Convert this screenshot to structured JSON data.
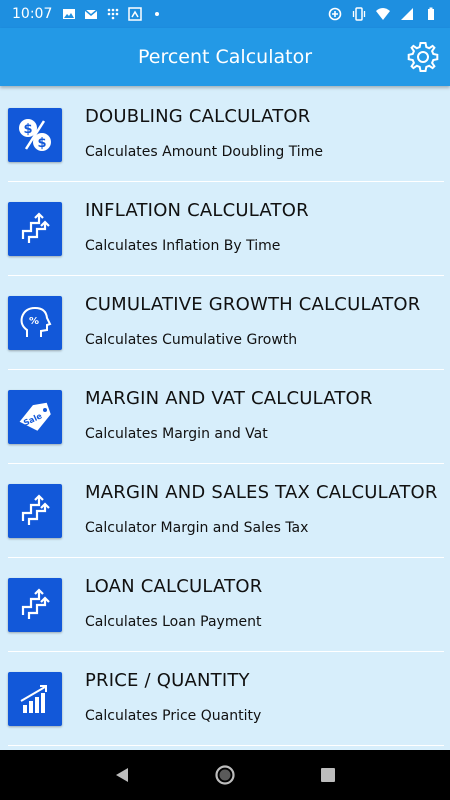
{
  "status_bar": {
    "time": "10:07",
    "icons_left": [
      "image-icon",
      "mail-icon",
      "dialpad-icon",
      "screen-icon",
      "dot-icon"
    ],
    "icons_right": [
      "data-saver-icon",
      "vibrate-icon",
      "wifi-icon",
      "signal-icon",
      "battery-icon"
    ]
  },
  "app_bar": {
    "title": "Percent Calculator",
    "settings_icon": "gear-icon"
  },
  "items": [
    {
      "title": "DOUBLING CALCULATOR",
      "subtitle": "Calculates Amount Doubling Time",
      "icon": "dollar-percent-icon"
    },
    {
      "title": "INFLATION CALCULATOR",
      "subtitle": "Calculates Inflation By Time",
      "icon": "arrows-icon"
    },
    {
      "title": "CUMULATIVE GROWTH CALCULATOR",
      "subtitle": "Calculates Cumulative Growth",
      "icon": "head-percent-icon"
    },
    {
      "title": "MARGIN AND VAT CALCULATOR",
      "subtitle": "Calculates Margin and Vat",
      "icon": "sale-tag-icon"
    },
    {
      "title": "MARGIN AND SALES TAX CALCULATOR",
      "subtitle": "Calculator Margin and Sales Tax",
      "icon": "arrows-icon"
    },
    {
      "title": "LOAN CALCULATOR",
      "subtitle": "Calculates Loan Payment",
      "icon": "arrows-icon"
    },
    {
      "title": "PRICE / QUANTITY",
      "subtitle": "Calculates Price Quantity",
      "icon": "bar-chart-icon"
    }
  ],
  "nav_bar": {
    "back_icon": "back-icon",
    "home_icon": "home-icon",
    "recents_icon": "recents-icon"
  },
  "colors": {
    "status_bar": "#1e8fe0",
    "app_bar": "#2399e6",
    "background": "#d7eefb",
    "tile": "#1258d9"
  }
}
